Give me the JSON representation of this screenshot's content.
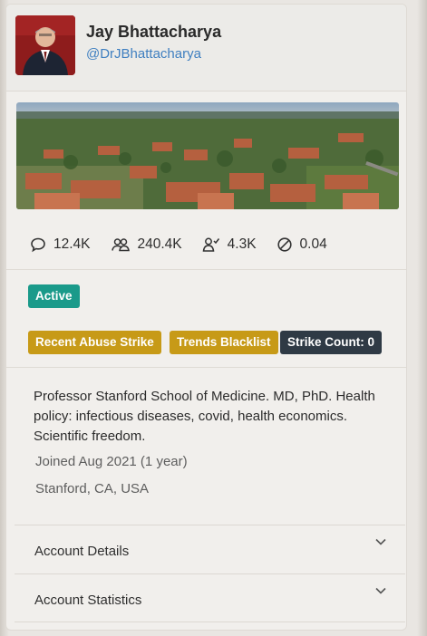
{
  "profile": {
    "name": "Jay Bhattacharya",
    "handle": "@DrJBhattacharya"
  },
  "stats": {
    "tweets": "12.4K",
    "followers": "240.4K",
    "following": "4.3K",
    "ratio": "0.04"
  },
  "badges": {
    "status": "Active",
    "abuse": "Recent Abuse Strike",
    "trends": "Trends Blacklist",
    "strike_count": "Strike Count: 0"
  },
  "bio": {
    "text": "Professor Stanford School of Medicine. MD, PhD. Health policy: infectious diseases, covid, health economics. Scientific freedom.",
    "joined": "Joined Aug 2021 (1 year)",
    "location": "Stanford, CA, USA"
  },
  "sections": {
    "details_label": "Account Details",
    "statistics_label": "Account Statistics"
  },
  "icons": {
    "tweets": "speech-bubble-icon",
    "followers": "people-icon",
    "following": "user-check-icon",
    "ratio": "circle-slash-icon",
    "expand": "chevron-down-icon"
  },
  "colors": {
    "active": "#1a9a8a",
    "warning": "#c79a17",
    "dark": "#2f3a45",
    "handle": "#3f7fc0"
  }
}
